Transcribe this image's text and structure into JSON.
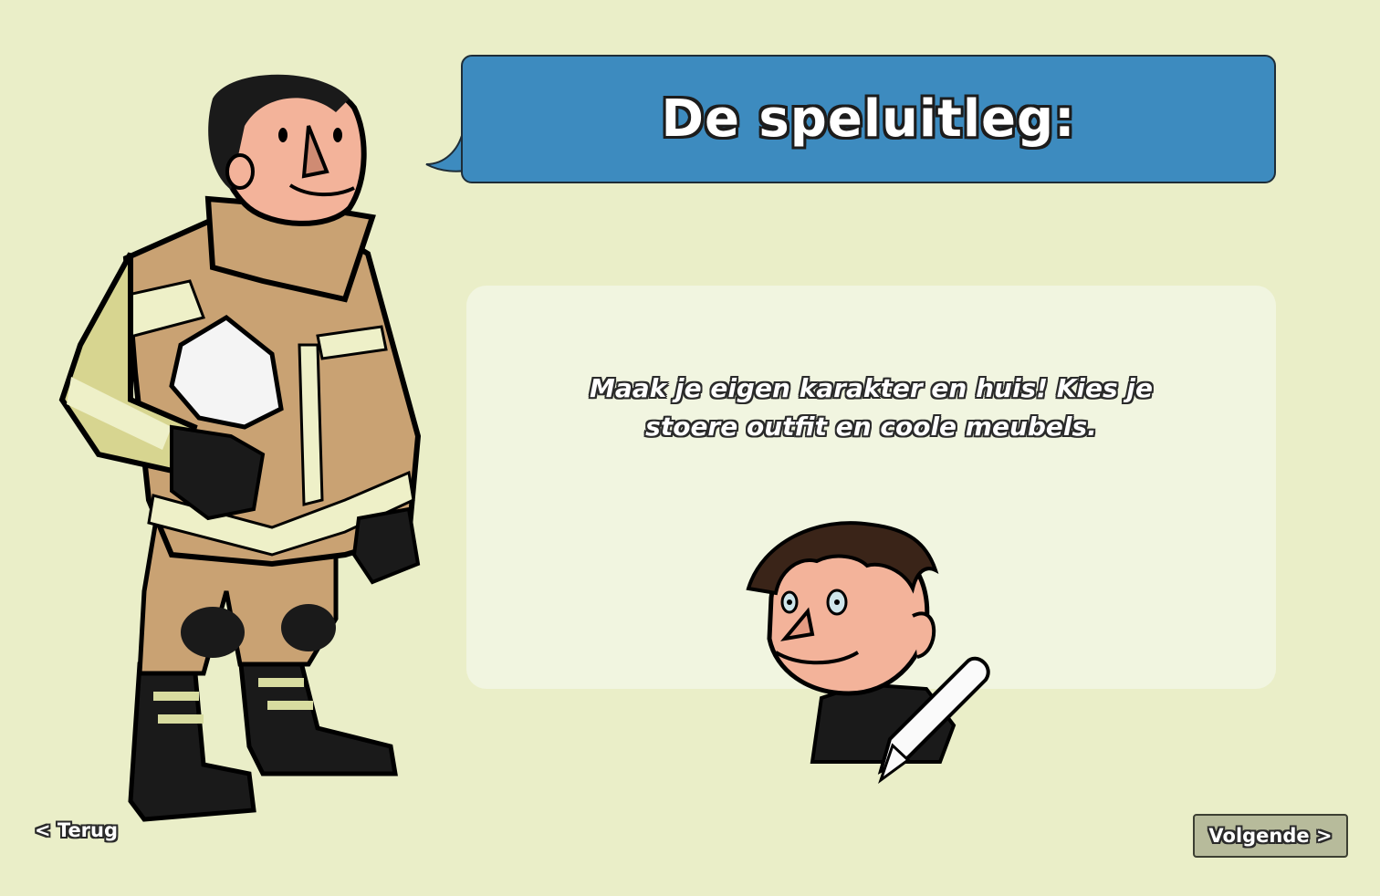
{
  "header": {
    "title": "De speluitleg:"
  },
  "panel": {
    "instruction": "Maak je eigen karakter en huis! Kies je stoere outfit en coole meubels."
  },
  "navigation": {
    "back_label": "< Terug",
    "next_label": "Volgende >"
  },
  "colors": {
    "background": "#eaeec8",
    "speech_bubble": "#3d8bbf",
    "panel": "#f1f5e0",
    "next_button": "#b7bb9b"
  },
  "illustrations": {
    "left_character": "firefighter-illustration",
    "avatar": "avatar-editor-illustration",
    "edit_icon": "pencil-icon"
  }
}
